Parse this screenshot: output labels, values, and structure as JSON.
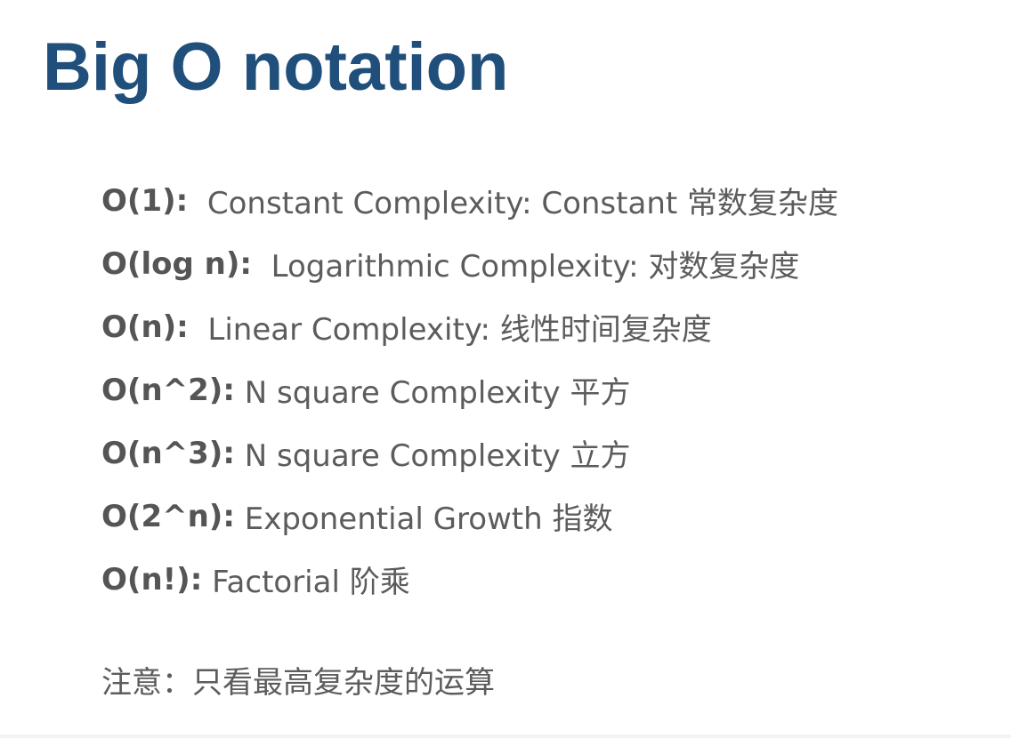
{
  "slide": {
    "title": "Big O notation",
    "items": [
      {
        "code": "O(1):",
        "text": "  Constant Complexity: Constant 常数复杂度"
      },
      {
        "code": "O(log n):",
        "text": "  Logarithmic Complexity: 对数复杂度"
      },
      {
        "code": "O(n):",
        "text": "  Linear Complexity: 线性时间复杂度"
      },
      {
        "code": "O(n^2):",
        "text": " N square Complexity 平方"
      },
      {
        "code": "O(n^3):",
        "text": " N square Complexity 立方"
      },
      {
        "code": "O(2^n):",
        "text": " Exponential Growth 指数"
      },
      {
        "code": "O(n!):",
        "text": " Factorial 阶乘"
      }
    ],
    "note": "注意：只看最高复杂度的运算"
  }
}
